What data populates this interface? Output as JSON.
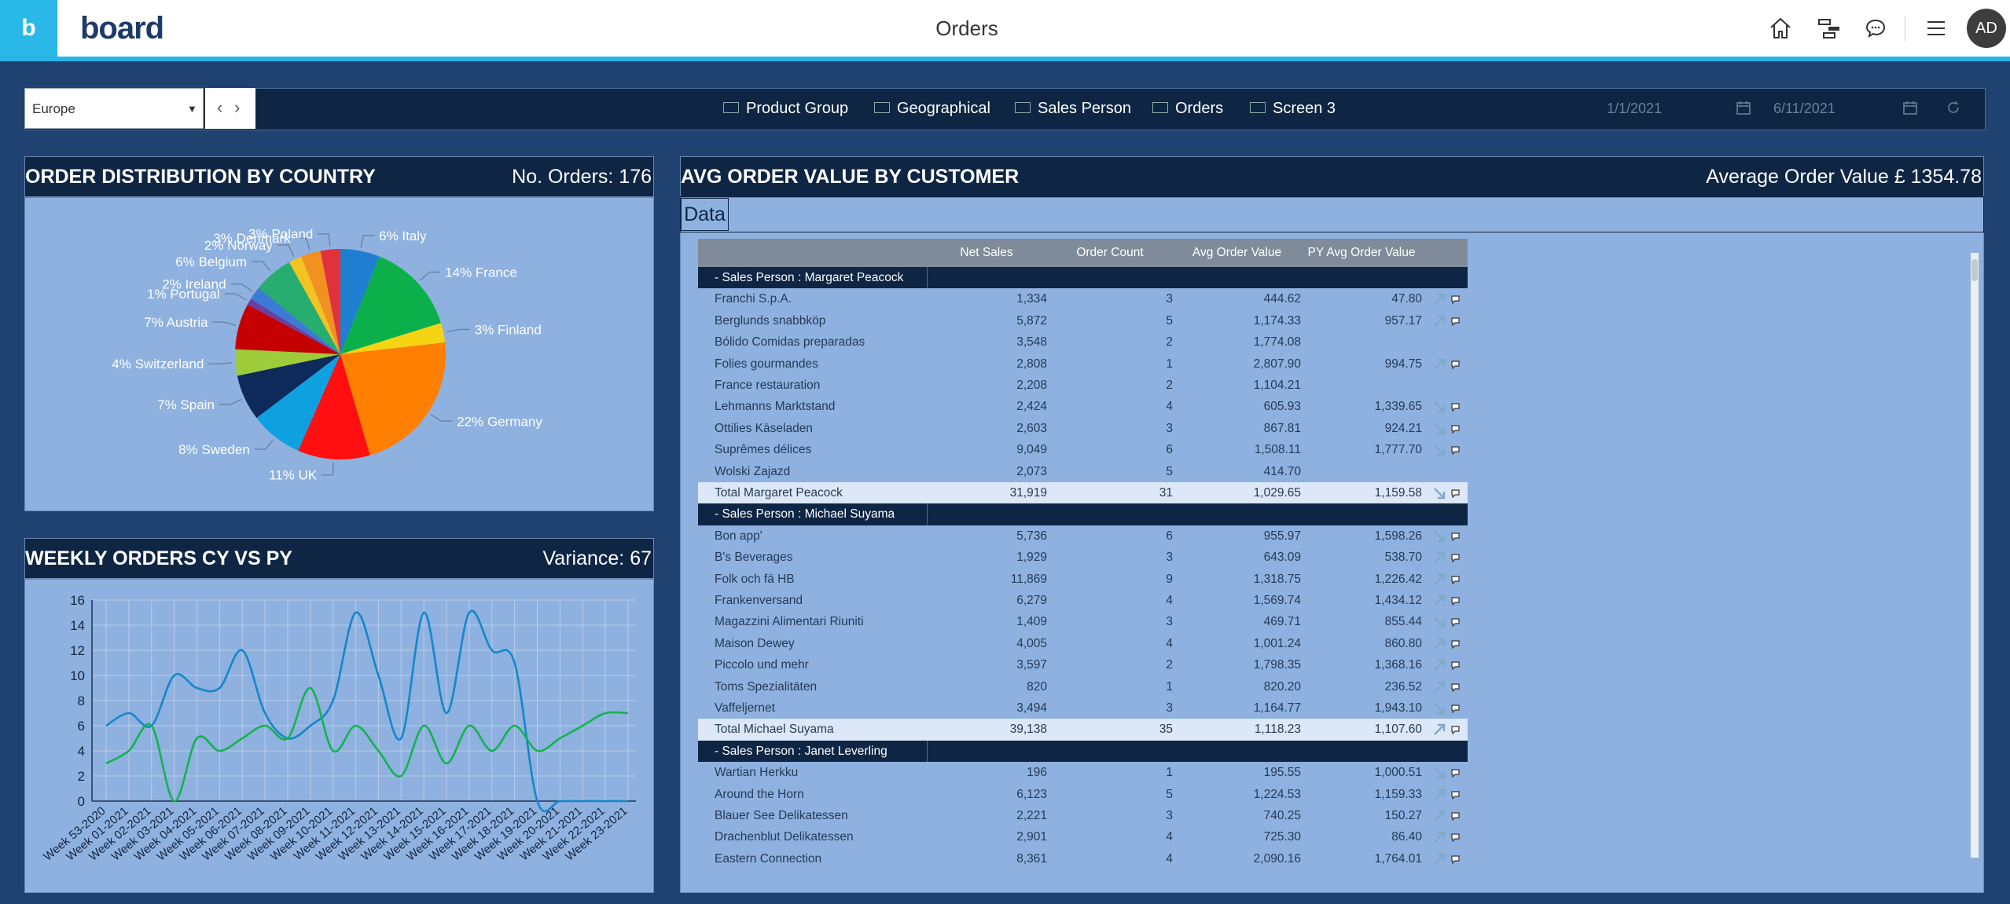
{
  "app": {
    "logo_letter": "b",
    "brand": "board",
    "page_title": "Orders",
    "avatar_initials": "AD"
  },
  "topbar_icons": [
    "home-icon",
    "hierarchy-icon",
    "chat-icon",
    "menu-icon"
  ],
  "nav": {
    "region": "Europe",
    "items": [
      "Product Group",
      "Geographical",
      "Sales Person",
      "Orders",
      "Screen 3"
    ],
    "date_from": "1/1/2021",
    "date_to": "6/11/2021"
  },
  "pie_panel": {
    "title": "ORDER DISTRIBUTION BY COUNTRY",
    "kpi": "No. Orders: 176"
  },
  "line_panel": {
    "title": "WEEKLY ORDERS CY VS PY",
    "kpi": "Variance: 67"
  },
  "table_panel": {
    "title": "AVG ORDER VALUE BY CUSTOMER",
    "kpi": "Average Order Value £ 1354.78",
    "tab": "Data",
    "headers": [
      "Net Sales",
      "Order Count",
      "Avg Order Value",
      "PY Avg Order Value"
    ],
    "rows": [
      {
        "type": "group",
        "customer": "-  Sales Person : Margaret Peacock"
      },
      {
        "type": "row",
        "customer": "Franchi S.p.A.",
        "net": "1,334",
        "count": "3",
        "avg": "444.62",
        "py": "47.80",
        "trend": "up"
      },
      {
        "type": "row",
        "customer": "Berglunds snabbköp",
        "net": "5,872",
        "count": "5",
        "avg": "1,174.33",
        "py": "957.17",
        "trend": "up"
      },
      {
        "type": "row",
        "customer": "Bólido Comidas preparadas",
        "net": "3,548",
        "count": "2",
        "avg": "1,774.08",
        "py": "",
        "trend": ""
      },
      {
        "type": "row",
        "customer": "Folies gourmandes",
        "net": "2,808",
        "count": "1",
        "avg": "2,807.90",
        "py": "994.75",
        "trend": "up"
      },
      {
        "type": "row",
        "customer": "France restauration",
        "net": "2,208",
        "count": "2",
        "avg": "1,104.21",
        "py": "",
        "trend": ""
      },
      {
        "type": "row",
        "customer": "Lehmanns Marktstand",
        "net": "2,424",
        "count": "4",
        "avg": "605.93",
        "py": "1,339.65",
        "trend": "down"
      },
      {
        "type": "row",
        "customer": "Ottilies Käseladen",
        "net": "2,603",
        "count": "3",
        "avg": "867.81",
        "py": "924.21",
        "trend": "down"
      },
      {
        "type": "row",
        "customer": "Suprêmes délices",
        "net": "9,049",
        "count": "6",
        "avg": "1,508.11",
        "py": "1,777.70",
        "trend": "down"
      },
      {
        "type": "row",
        "customer": "Wolski  Zajazd",
        "net": "2,073",
        "count": "5",
        "avg": "414.70",
        "py": "",
        "trend": ""
      },
      {
        "type": "total",
        "customer": "Total Margaret Peacock",
        "net": "31,919",
        "count": "31",
        "avg": "1,029.65",
        "py": "1,159.58",
        "trend": "down"
      },
      {
        "type": "group",
        "customer": "-  Sales Person : Michael Suyama"
      },
      {
        "type": "row",
        "customer": "Bon app'",
        "net": "5,736",
        "count": "6",
        "avg": "955.97",
        "py": "1,598.26",
        "trend": "down"
      },
      {
        "type": "row",
        "customer": "B's Beverages",
        "net": "1,929",
        "count": "3",
        "avg": "643.09",
        "py": "538.70",
        "trend": "up"
      },
      {
        "type": "row",
        "customer": "Folk och fä HB",
        "net": "11,869",
        "count": "9",
        "avg": "1,318.75",
        "py": "1,226.42",
        "trend": "up"
      },
      {
        "type": "row",
        "customer": "Frankenversand",
        "net": "6,279",
        "count": "4",
        "avg": "1,569.74",
        "py": "1,434.12",
        "trend": "up"
      },
      {
        "type": "row",
        "customer": "Magazzini Alimentari Riuniti",
        "net": "1,409",
        "count": "3",
        "avg": "469.71",
        "py": "855.44",
        "trend": "down"
      },
      {
        "type": "row",
        "customer": "Maison Dewey",
        "net": "4,005",
        "count": "4",
        "avg": "1,001.24",
        "py": "860.80",
        "trend": "up"
      },
      {
        "type": "row",
        "customer": "Piccolo und mehr",
        "net": "3,597",
        "count": "2",
        "avg": "1,798.35",
        "py": "1,368.16",
        "trend": "up"
      },
      {
        "type": "row",
        "customer": "Toms Spezialitäten",
        "net": "820",
        "count": "1",
        "avg": "820.20",
        "py": "236.52",
        "trend": "up"
      },
      {
        "type": "row",
        "customer": "Vaffeljernet",
        "net": "3,494",
        "count": "3",
        "avg": "1,164.77",
        "py": "1,943.10",
        "trend": "down"
      },
      {
        "type": "total",
        "customer": "Total Michael Suyama",
        "net": "39,138",
        "count": "35",
        "avg": "1,118.23",
        "py": "1,107.60",
        "trend": "up"
      },
      {
        "type": "group",
        "customer": "-  Sales Person : Janet Leverling"
      },
      {
        "type": "row",
        "customer": "Wartian Herkku",
        "net": "196",
        "count": "1",
        "avg": "195.55",
        "py": "1,000.51",
        "trend": "down"
      },
      {
        "type": "row",
        "customer": "Around the Horn",
        "net": "6,123",
        "count": "5",
        "avg": "1,224.53",
        "py": "1,159.33",
        "trend": "up"
      },
      {
        "type": "row",
        "customer": "Blauer See Delikatessen",
        "net": "2,221",
        "count": "3",
        "avg": "740.25",
        "py": "150.27",
        "trend": "up"
      },
      {
        "type": "row",
        "customer": "Drachenblut Delikatessen",
        "net": "2,901",
        "count": "4",
        "avg": "725.30",
        "py": "86.40",
        "trend": "up"
      },
      {
        "type": "row",
        "customer": "Eastern Connection",
        "net": "8,361",
        "count": "4",
        "avg": "2,090.16",
        "py": "1,764.01",
        "trend": "up"
      }
    ]
  },
  "colors": {
    "brand": "#2ab8e8",
    "panel_header": "#0e2544",
    "panel_body": "#8eb1df",
    "page_bg": "#1f4271",
    "up": "#7fa9c9",
    "down": "#7fa9c9"
  },
  "chart_data": [
    {
      "type": "pie",
      "categories": [
        "Italy",
        "France",
        "Finland",
        "Germany",
        "UK",
        "Sweden",
        "Spain",
        "Switzerland",
        "Austria",
        "Portugal",
        "Ireland",
        "Belgium",
        "Norway",
        "Denmark",
        "Poland"
      ],
      "values": [
        6,
        14,
        3,
        22,
        11,
        8,
        7,
        4,
        7,
        1,
        2,
        6,
        2,
        3,
        3
      ],
      "labels": [
        "6% Italy",
        "14% France",
        "3% Finland",
        "22% Germany",
        "11% UK",
        "8% Sweden",
        "7% Spain",
        "4% Switzerland",
        "7% Austria",
        "1% Portugal",
        "2% Ireland",
        "6% Belgium",
        "2% Norway",
        "3% Denmark",
        "3% Poland"
      ],
      "colors": [
        "#1f7ecf",
        "#0cb04a",
        "#f5d414",
        "#ff7f00",
        "#ff0f0f",
        "#0fa0e0",
        "#0d2a5a",
        "#9dcb3a",
        "#c40000",
        "#6a3fa0",
        "#3c7bd4",
        "#27ad6f",
        "#f3c321",
        "#f29022",
        "#e3313b"
      ]
    },
    {
      "type": "line",
      "categories": [
        "Week 53-2020",
        "Week 01-2021",
        "Week 02-2021",
        "Week 03-2021",
        "Week 04-2021",
        "Week 05-2021",
        "Week 06-2021",
        "Week 07-2021",
        "Week 08-2021",
        "Week 09-2021",
        "Week 10-2021",
        "Week 11-2021",
        "Week 12-2021",
        "Week 13-2021",
        "Week 14-2021",
        "Week 15-2021",
        "Week 16-2021",
        "Week 17-2021",
        "Week 18-2021",
        "Week 19-2021",
        "Week 20-2021",
        "Week 21-2021",
        "Week 22-2021",
        "Week 23-2021"
      ],
      "ylim": [
        0,
        16
      ],
      "yticks": [
        0,
        2,
        4,
        6,
        8,
        10,
        12,
        14,
        16
      ],
      "grid": true,
      "series": [
        {
          "color": "#1686c9",
          "values": [
            6,
            7,
            6,
            10,
            9,
            9,
            12,
            7,
            5,
            6,
            8,
            15,
            10,
            5,
            15,
            7,
            15,
            12,
            11,
            0,
            0,
            0,
            0,
            0
          ]
        },
        {
          "color": "#13b34f",
          "values": [
            3,
            4,
            6,
            0,
            5,
            4,
            5,
            6,
            5,
            9,
            4,
            6,
            4,
            2,
            6,
            3,
            6,
            4,
            6,
            4,
            5,
            6,
            7,
            7
          ]
        }
      ]
    }
  ]
}
